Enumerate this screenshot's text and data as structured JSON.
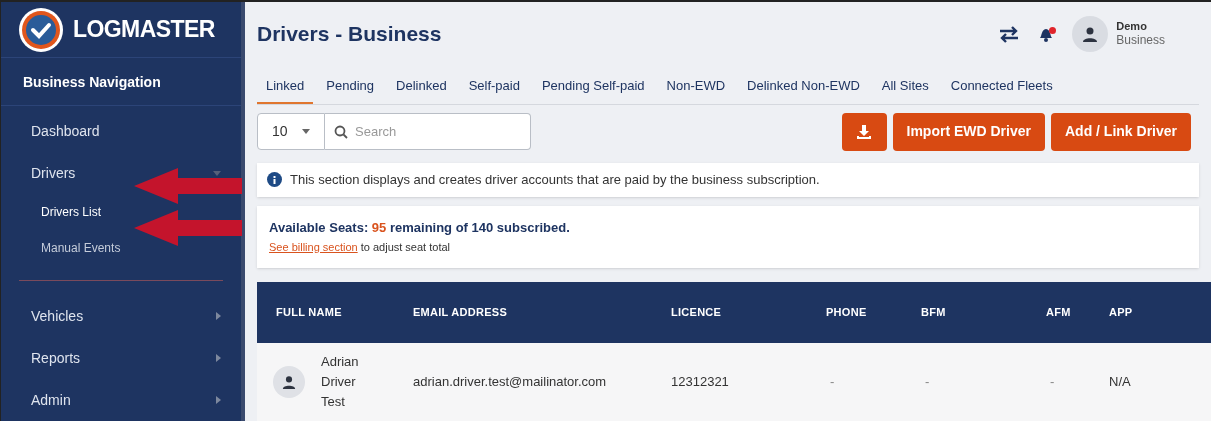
{
  "brand": {
    "name": "LOGMASTER"
  },
  "sidebar": {
    "heading": "Business Navigation",
    "items": [
      {
        "label": "Dashboard",
        "kind": "link",
        "selected": false
      },
      {
        "label": "Drivers",
        "kind": "group",
        "expanded": true,
        "selected": false,
        "children": [
          {
            "label": "Drivers List",
            "selected": true
          },
          {
            "label": "Manual Events",
            "selected": false
          }
        ]
      },
      {
        "label": "Vehicles",
        "kind": "group",
        "expanded": false,
        "selected": false,
        "divider_before": true
      },
      {
        "label": "Reports",
        "kind": "group",
        "expanded": false,
        "selected": false
      },
      {
        "label": "Admin",
        "kind": "group",
        "expanded": false,
        "selected": false
      }
    ]
  },
  "annotations": [
    {
      "kind": "arrow"
    },
    {
      "kind": "arrow"
    }
  ],
  "page": {
    "title": "Drivers - Business"
  },
  "user": {
    "name": "Demo",
    "role": "Business",
    "has_notification": true
  },
  "tabs": [
    {
      "label": "Linked",
      "selected": true
    },
    {
      "label": "Pending",
      "selected": false
    },
    {
      "label": "Delinked",
      "selected": false
    },
    {
      "label": "Self-paid",
      "selected": false
    },
    {
      "label": "Pending Self-paid",
      "selected": false
    },
    {
      "label": "Non-EWD",
      "selected": false
    },
    {
      "label": "Delinked Non-EWD",
      "selected": false
    },
    {
      "label": "All Sites",
      "selected": false
    },
    {
      "label": "Connected Fleets",
      "selected": false
    }
  ],
  "toolbar": {
    "page_size": "10",
    "search": {
      "placeholder": "Search"
    },
    "buttons": [
      {
        "kind": "download"
      },
      {
        "kind": "text",
        "label": "Import EWD Driver"
      },
      {
        "kind": "text",
        "label": "Add / Link Driver"
      }
    ]
  },
  "info": "This section displays and creates driver accounts that are paid by the business subscription.",
  "seats": {
    "label": "Available Seats:",
    "remaining": "95",
    "rest": "remaining of 140 subscribed.",
    "link": "See billing section",
    "after_link": "to adjust seat total"
  },
  "table": {
    "columns": [
      "FULL NAME",
      "EMAIL ADDRESS",
      "LICENCE",
      "PHONE",
      "BFM",
      "AFM",
      "APP"
    ],
    "rows": [
      {
        "cells": [
          "Adrian Driver Test",
          "adrian.driver.test@mailinator.com",
          "12312321",
          "-",
          "-",
          "-",
          "N/A"
        ]
      }
    ]
  }
}
